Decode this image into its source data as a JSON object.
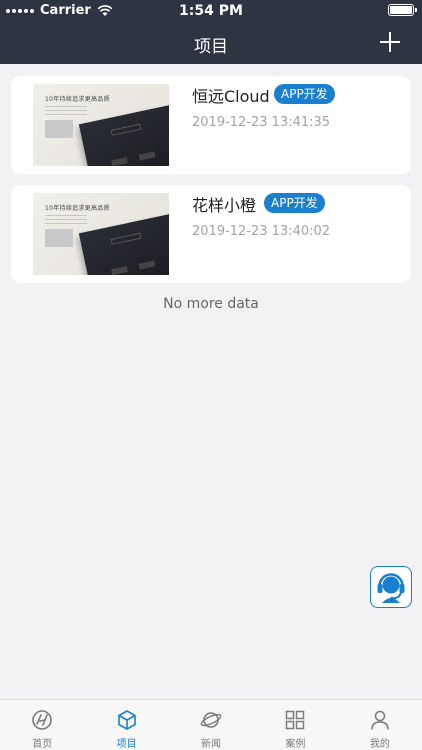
{
  "status_bar": {
    "carrier": "Carrier",
    "time": "1:54 PM"
  },
  "nav": {
    "title": "项目",
    "add_icon": "plus-icon"
  },
  "projects": [
    {
      "name": "恒远Cloud",
      "tag": "APP开发",
      "date": "2019-12-23 13:41:35",
      "thumb_caption": "10年持续追求更高品质"
    },
    {
      "name": "花样小橙",
      "tag": "APP开发",
      "date": "2019-12-23 13:40:02",
      "thumb_caption": "10年持续追求更高品质"
    }
  ],
  "list_footer": "No more data",
  "service_button": {
    "icon": "customer-service-headset-icon"
  },
  "tabs": [
    {
      "label": "首页",
      "icon": "home-logo-icon",
      "active": false
    },
    {
      "label": "项目",
      "icon": "cube-icon",
      "active": true
    },
    {
      "label": "新闻",
      "icon": "planet-icon",
      "active": false
    },
    {
      "label": "案例",
      "icon": "grid-icon",
      "active": false
    },
    {
      "label": "我的",
      "icon": "person-icon",
      "active": false
    }
  ],
  "colors": {
    "header": "#2e3441",
    "accent": "#1b7fd0",
    "background": "#f2f2f4"
  }
}
